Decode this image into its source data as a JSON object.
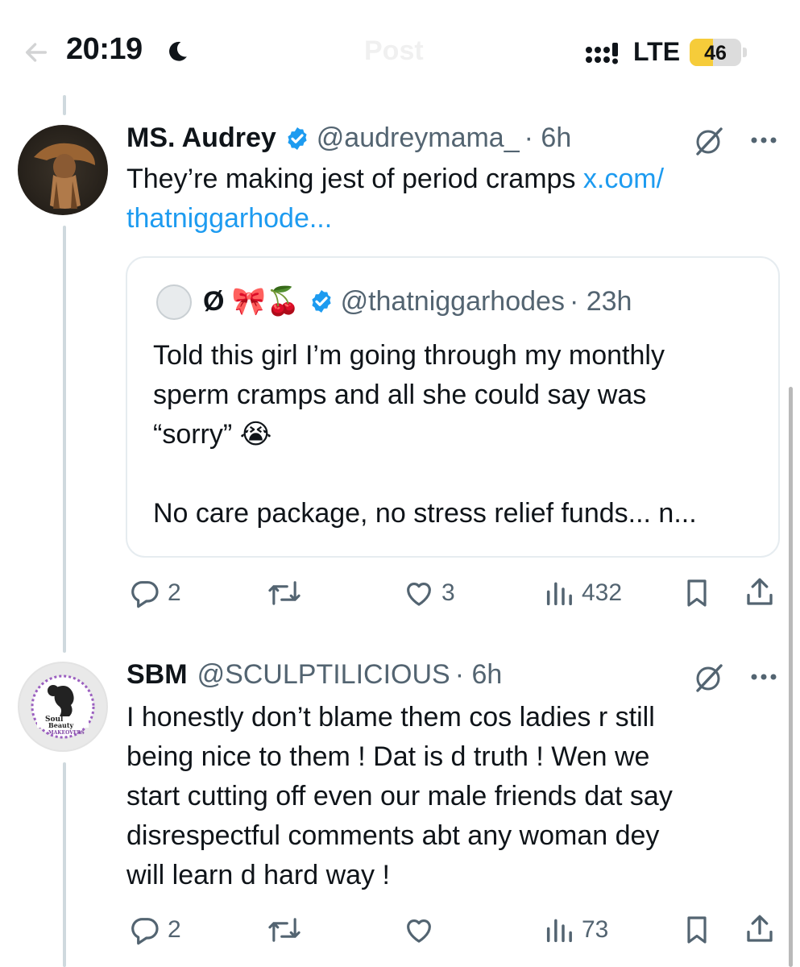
{
  "status_bar": {
    "time": "20:19",
    "network": "LTE",
    "battery": "46",
    "battery_level": 0.46
  },
  "header": {
    "title": "Post"
  },
  "colors": {
    "accent": "#1d9bf0",
    "handle": "#536471",
    "divider": "#cfd9de"
  },
  "posts": [
    {
      "name": "MS. Audrey",
      "handle": "@audreymama_",
      "time": "· 6h",
      "lines": [
        "They’re making jest of period cramps ",
        "x.com/",
        "thatniggarhode..."
      ],
      "quote": {
        "name": "Ø 🎀🍒",
        "handle": "@thatniggarhodes",
        "time": "· 23h",
        "lines": [
          "Told this girl I’m going through my monthly",
          "sperm cramps and all she could say was",
          "“sorry” 😭",
          "No care package, no stress relief funds... n..."
        ]
      },
      "actions": {
        "replies": "2",
        "reposts": "",
        "likes": "3",
        "views": "432"
      }
    },
    {
      "name": "SBM",
      "handle": "@SCULPTILICIOUS",
      "time": "· 6h",
      "avatar_text": [
        "Soul",
        "Beauty",
        "MAKEOVERS"
      ],
      "lines": [
        "I honestly don’t blame them cos ladies r still",
        "being nice to them ! Dat is d truth ! Wen we",
        "start cutting off even our male friends dat say",
        "disrespectful comments abt any woman dey",
        "will learn d hard way !"
      ],
      "actions": {
        "replies": "2",
        "reposts": "",
        "likes": "",
        "views": "73"
      }
    }
  ]
}
